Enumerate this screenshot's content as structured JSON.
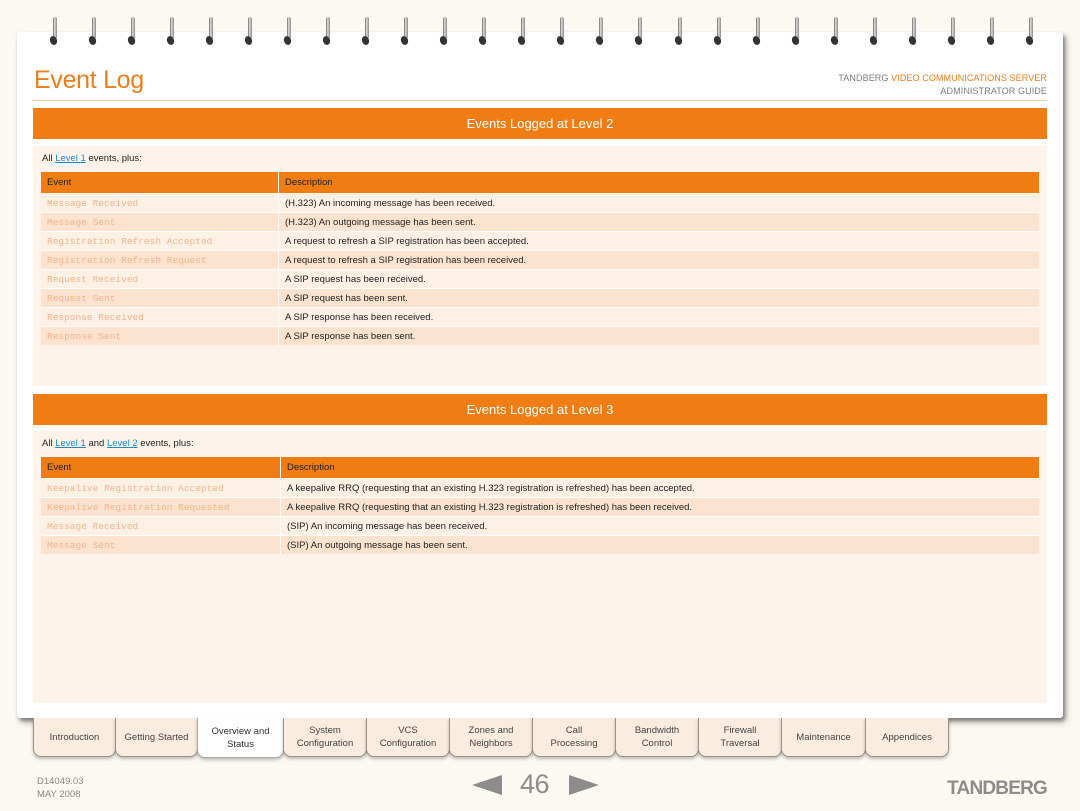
{
  "header": {
    "title": "Event Log",
    "brand_prefix": "TANDBERG",
    "brand_product": "VIDEO COMMUNICATIONS SERVER",
    "brand_subtitle": "ADMINISTRATOR GUIDE"
  },
  "colors": {
    "accent": "#ef7d14",
    "link": "#1a8ad4",
    "event_text": "#f4b38c"
  },
  "sections": [
    {
      "title": "Events Logged at Level 2",
      "intro_prefix": "All ",
      "intro_links": [
        "Level 1"
      ],
      "intro_joiners": [],
      "intro_suffix": " events, plus:",
      "columns": [
        "Event",
        "Description"
      ],
      "rows": [
        {
          "event": "Message Received",
          "description": "(H.323) An incoming message has been received."
        },
        {
          "event": "Message Sent",
          "description": "(H.323) An outgoing message has been sent."
        },
        {
          "event": "Registration Refresh Accepted",
          "description": "A request to refresh a SIP registration has been accepted."
        },
        {
          "event": "Registration Refresh Request",
          "description": "A request to refresh a SIP registration has been received."
        },
        {
          "event": "Request Received",
          "description": "A SIP request has been received."
        },
        {
          "event": "Request Sent",
          "description": "A SIP request has been sent."
        },
        {
          "event": "Response Received",
          "description": "A SIP response has been received."
        },
        {
          "event": "Response Sent",
          "description": "A SIP response has been sent."
        }
      ]
    },
    {
      "title": "Events Logged at Level 3",
      "intro_prefix": "All ",
      "intro_links": [
        "Level 1",
        "Level 2"
      ],
      "intro_joiners": [
        " and "
      ],
      "intro_suffix": " events, plus:",
      "columns": [
        "Event",
        "Description"
      ],
      "rows": [
        {
          "event": "Keepalive Registration Accepted",
          "description": "A keepalive RRQ (requesting that an existing H.323 registration is refreshed) has been accepted."
        },
        {
          "event": "Keepalive Registration Requested",
          "description": "A keepalive RRQ (requesting that an existing H.323 registration is refreshed) has been received."
        },
        {
          "event": "Message Received",
          "description": "(SIP) An incoming message has been received."
        },
        {
          "event": "Message Sent",
          "description": "(SIP) An outgoing message has been sent."
        }
      ]
    }
  ],
  "tabs": [
    {
      "line1": "Introduction",
      "line2": "",
      "active": false
    },
    {
      "line1": "Getting Started",
      "line2": "",
      "active": false
    },
    {
      "line1": "Overview and",
      "line2": "Status",
      "active": true
    },
    {
      "line1": "System",
      "line2": "Configuration",
      "active": false
    },
    {
      "line1": "VCS",
      "line2": "Configuration",
      "active": false
    },
    {
      "line1": "Zones and",
      "line2": "Neighbors",
      "active": false
    },
    {
      "line1": "Call",
      "line2": "Processing",
      "active": false
    },
    {
      "line1": "Bandwidth",
      "line2": "Control",
      "active": false
    },
    {
      "line1": "Firewall",
      "line2": "Traversal",
      "active": false
    },
    {
      "line1": "Maintenance",
      "line2": "",
      "active": false
    },
    {
      "line1": "Appendices",
      "line2": "",
      "active": false
    }
  ],
  "footer": {
    "doc_id": "D14049.03",
    "date": "MAY 2008",
    "page_number": "46",
    "prev_icon": "triangle-left-icon",
    "next_icon": "triangle-right-icon",
    "logo": "TANDBERG"
  }
}
